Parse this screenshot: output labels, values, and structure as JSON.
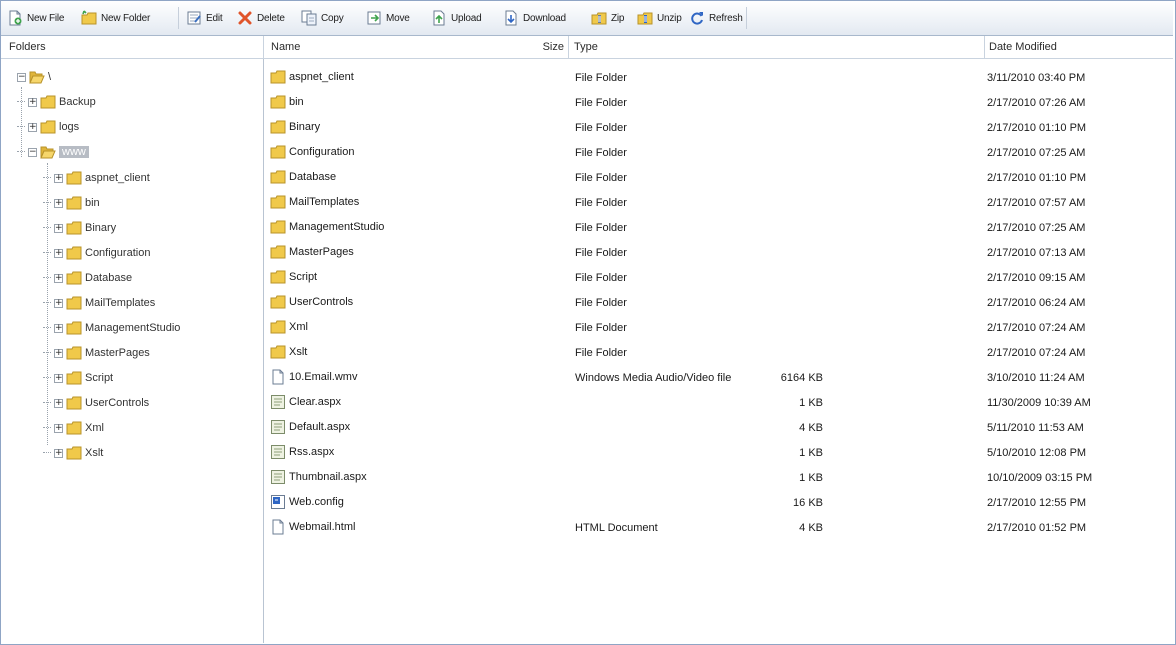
{
  "toolbar": {
    "new_file": "New File",
    "new_folder": "New Folder",
    "edit": "Edit",
    "delete": "Delete",
    "copy": "Copy",
    "move": "Move",
    "upload": "Upload",
    "download": "Download",
    "zip": "Zip",
    "unzip": "Unzip",
    "refresh": "Refresh"
  },
  "columns": {
    "folders": "Folders",
    "name": "Name",
    "size": "Size",
    "type": "Type",
    "date_modified": "Date Modified"
  },
  "tree": {
    "root": "\\",
    "level1": [
      "Backup",
      "logs",
      "www"
    ],
    "selected": "www",
    "www_children": [
      "aspnet_client",
      "bin",
      "Binary",
      "Configuration",
      "Database",
      "MailTemplates",
      "ManagementStudio",
      "MasterPages",
      "Script",
      "UserControls",
      "Xml",
      "Xslt"
    ]
  },
  "files": [
    {
      "name": "aspnet_client",
      "size": "",
      "type": "File Folder",
      "date": "3/11/2010 03:40 PM",
      "icon": "folder-icon"
    },
    {
      "name": "bin",
      "size": "",
      "type": "File Folder",
      "date": "2/17/2010 07:26 AM",
      "icon": "folder-icon"
    },
    {
      "name": "Binary",
      "size": "",
      "type": "File Folder",
      "date": "2/17/2010 01:10 PM",
      "icon": "folder-icon"
    },
    {
      "name": "Configuration",
      "size": "",
      "type": "File Folder",
      "date": "2/17/2010 07:25 AM",
      "icon": "folder-icon"
    },
    {
      "name": "Database",
      "size": "",
      "type": "File Folder",
      "date": "2/17/2010 01:10 PM",
      "icon": "folder-icon"
    },
    {
      "name": "MailTemplates",
      "size": "",
      "type": "File Folder",
      "date": "2/17/2010 07:57 AM",
      "icon": "folder-icon"
    },
    {
      "name": "ManagementStudio",
      "size": "",
      "type": "File Folder",
      "date": "2/17/2010 07:25 AM",
      "icon": "folder-icon"
    },
    {
      "name": "MasterPages",
      "size": "",
      "type": "File Folder",
      "date": "2/17/2010 07:13 AM",
      "icon": "folder-icon"
    },
    {
      "name": "Script",
      "size": "",
      "type": "File Folder",
      "date": "2/17/2010 09:15 AM",
      "icon": "folder-icon"
    },
    {
      "name": "UserControls",
      "size": "",
      "type": "File Folder",
      "date": "2/17/2010 06:24 AM",
      "icon": "folder-icon"
    },
    {
      "name": "Xml",
      "size": "",
      "type": "File Folder",
      "date": "2/17/2010 07:24 AM",
      "icon": "folder-icon"
    },
    {
      "name": "Xslt",
      "size": "",
      "type": "File Folder",
      "date": "2/17/2010 07:24 AM",
      "icon": "folder-icon"
    },
    {
      "name": "10.Email.wmv",
      "size": "6164 KB",
      "type": "Windows Media Audio/Video file",
      "date": "3/10/2010 11:24 AM",
      "icon": "media-file-icon"
    },
    {
      "name": "Clear.aspx",
      "size": "1 KB",
      "type": "",
      "date": "11/30/2009 10:39 AM",
      "icon": "aspx-file-icon"
    },
    {
      "name": "Default.aspx",
      "size": "4 KB",
      "type": "",
      "date": "5/11/2010 11:53 AM",
      "icon": "aspx-file-icon"
    },
    {
      "name": "Rss.aspx",
      "size": "1 KB",
      "type": "",
      "date": "5/10/2010 12:08 PM",
      "icon": "aspx-file-icon"
    },
    {
      "name": "Thumbnail.aspx",
      "size": "1 KB",
      "type": "",
      "date": "10/10/2009 03:15 PM",
      "icon": "aspx-file-icon"
    },
    {
      "name": "Web.config",
      "size": "16 KB",
      "type": "",
      "date": "2/17/2010 12:55 PM",
      "icon": "config-file-icon"
    },
    {
      "name": "Webmail.html",
      "size": "4 KB",
      "type": "HTML Document",
      "date": "2/17/2010 01:52 PM",
      "icon": "html-file-icon"
    }
  ],
  "colors": {
    "folder": "#f0c94a",
    "border": "#8fa5c5",
    "selection": "#b7bcc4",
    "delete_icon": "#e0542a"
  }
}
